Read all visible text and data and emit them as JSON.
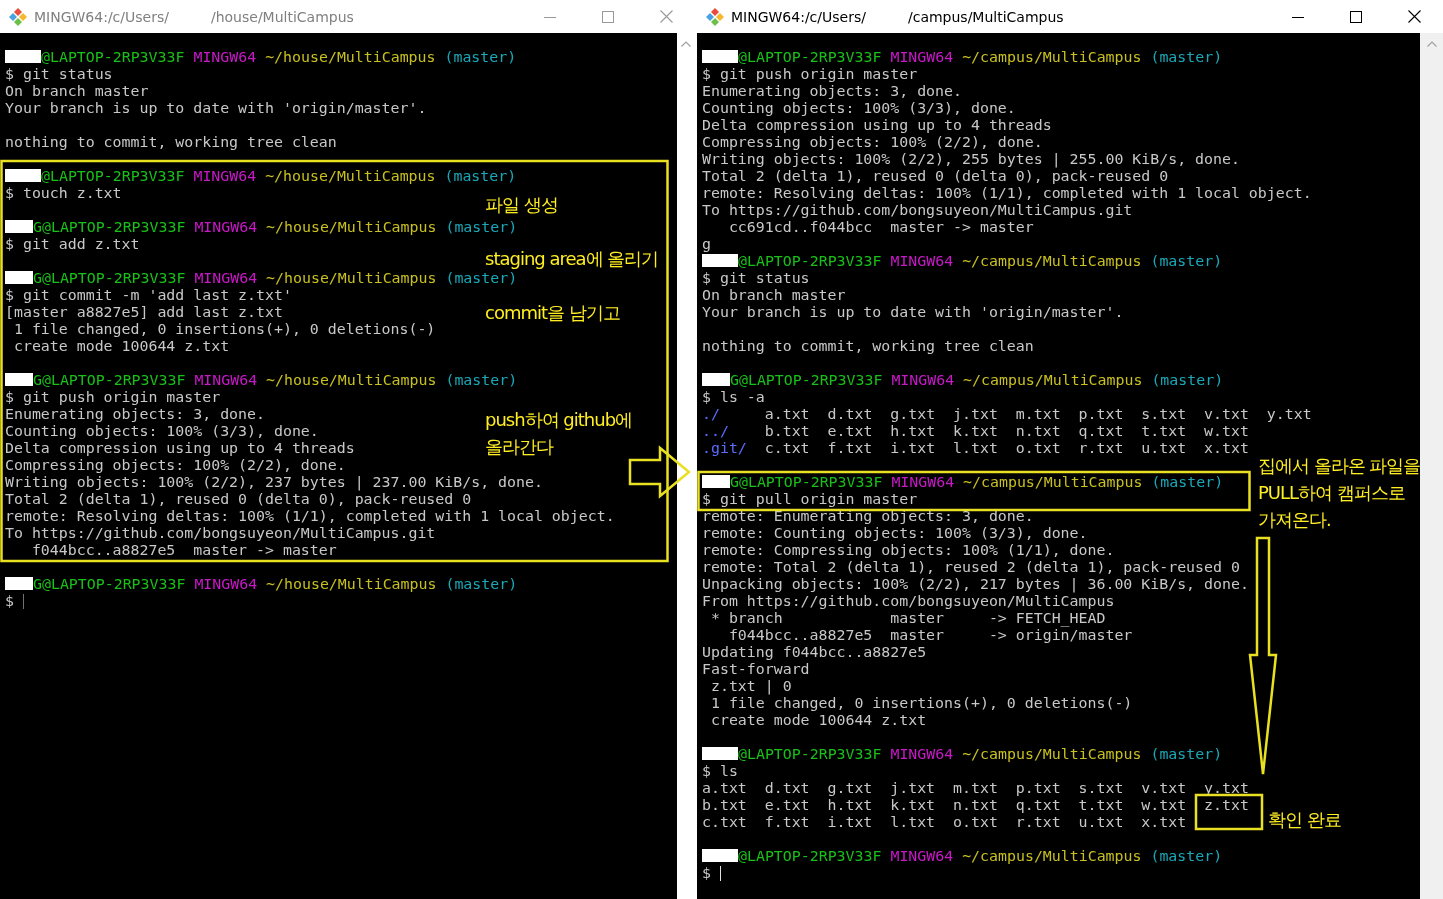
{
  "windows": [
    {
      "title_start": "MINGW64:/c/Users/",
      "title_end": "/house/MultiCampus",
      "active": false,
      "lines": [
        {
          "kind": "prompt",
          "host": "@LAPTOP-2RP3V33F",
          "system": "MINGW64",
          "path": "~/house/MultiCampus",
          "branch": "(master)"
        },
        {
          "kind": "output",
          "text": "$ git status"
        },
        {
          "kind": "output",
          "text": "On branch master"
        },
        {
          "kind": "output",
          "text": "Your branch is up to date with 'origin/master'."
        },
        {
          "kind": "blank"
        },
        {
          "kind": "output",
          "text": "nothing to commit, working tree clean"
        },
        {
          "kind": "blank"
        },
        {
          "kind": "prompt",
          "host": "@LAPTOP-2RP3V33F",
          "system": "MINGW64",
          "path": "~/house/MultiCampus",
          "branch": "(master)"
        },
        {
          "kind": "output",
          "text": "$ touch z.txt"
        },
        {
          "kind": "blank"
        },
        {
          "kind": "prompt",
          "user_fragment": "G",
          "host": "@LAPTOP-2RP3V33F",
          "system": "MINGW64",
          "path": "~/house/MultiCampus",
          "branch": "(master)"
        },
        {
          "kind": "output",
          "text": "$ git add z.txt"
        },
        {
          "kind": "blank"
        },
        {
          "kind": "prompt",
          "user_fragment": "G",
          "host": "@LAPTOP-2RP3V33F",
          "system": "MINGW64",
          "path": "~/house/MultiCampus",
          "branch": "(master)"
        },
        {
          "kind": "output",
          "text": "$ git commit -m 'add last z.txt'"
        },
        {
          "kind": "output",
          "text": "[master a8827e5] add last z.txt"
        },
        {
          "kind": "output",
          "text": " 1 file changed, 0 insertions(+), 0 deletions(-)"
        },
        {
          "kind": "output",
          "text": " create mode 100644 z.txt"
        },
        {
          "kind": "blank"
        },
        {
          "kind": "prompt",
          "user_fragment": "G",
          "host": "@LAPTOP-2RP3V33F",
          "system": "MINGW64",
          "path": "~/house/MultiCampus",
          "branch": "(master)"
        },
        {
          "kind": "output",
          "text": "$ git push origin master"
        },
        {
          "kind": "output",
          "text": "Enumerating objects: 3, done."
        },
        {
          "kind": "output",
          "text": "Counting objects: 100% (3/3), done."
        },
        {
          "kind": "output",
          "text": "Delta compression using up to 4 threads"
        },
        {
          "kind": "output",
          "text": "Compressing objects: 100% (2/2), done."
        },
        {
          "kind": "output",
          "text": "Writing objects: 100% (2/2), 237 bytes | 237.00 KiB/s, done."
        },
        {
          "kind": "output",
          "text": "Total 2 (delta 1), reused 0 (delta 0), pack-reused 0"
        },
        {
          "kind": "output",
          "text": "remote: Resolving deltas: 100% (1/1), completed with 1 local object."
        },
        {
          "kind": "output",
          "text": "To https://github.com/bongsuyeon/MultiCampus.git"
        },
        {
          "kind": "output",
          "text": "   f044bcc..a8827e5  master -> master"
        },
        {
          "kind": "blank"
        },
        {
          "kind": "prompt",
          "user_fragment": "G",
          "host": "@LAPTOP-2RP3V33F",
          "system": "MINGW64",
          "path": "~/house/MultiCampus",
          "branch": "(master)"
        },
        {
          "kind": "input",
          "text": "$"
        }
      ]
    },
    {
      "title_start": "MINGW64:/c/Users/",
      "title_end": "/campus/MultiCampus",
      "active": true,
      "lines": [
        {
          "kind": "prompt",
          "host": "@LAPTOP-2RP3V33F",
          "system": "MINGW64",
          "path": "~/campus/MultiCampus",
          "branch": "(master)"
        },
        {
          "kind": "output",
          "text": "$ git push origin master"
        },
        {
          "kind": "output",
          "text": "Enumerating objects: 3, done."
        },
        {
          "kind": "output",
          "text": "Counting objects: 100% (3/3), done."
        },
        {
          "kind": "output",
          "text": "Delta compression using up to 4 threads"
        },
        {
          "kind": "output",
          "text": "Compressing objects: 100% (2/2), done."
        },
        {
          "kind": "output",
          "text": "Writing objects: 100% (2/2), 255 bytes | 255.00 KiB/s, done."
        },
        {
          "kind": "output",
          "text": "Total 2 (delta 1), reused 0 (delta 0), pack-reused 0"
        },
        {
          "kind": "output",
          "text": "remote: Resolving deltas: 100% (1/1), completed with 1 local object."
        },
        {
          "kind": "output",
          "text": "To https://github.com/bongsuyeon/MultiCampus.git"
        },
        {
          "kind": "output",
          "text": "   cc691cd..f044bcc  master -> master"
        },
        {
          "kind": "output",
          "text": "g"
        },
        {
          "kind": "prompt",
          "host": "@LAPTOP-2RP3V33F",
          "system": "MINGW64",
          "path": "~/campus/MultiCampus",
          "branch": "(master)"
        },
        {
          "kind": "output",
          "text": "$ git status"
        },
        {
          "kind": "output",
          "text": "On branch master"
        },
        {
          "kind": "output",
          "text": "Your branch is up to date with 'origin/master'."
        },
        {
          "kind": "blank"
        },
        {
          "kind": "output",
          "text": "nothing to commit, working tree clean"
        },
        {
          "kind": "blank"
        },
        {
          "kind": "prompt",
          "user_fragment": "G",
          "host": "@LAPTOP-2RP3V33F",
          "system": "MINGW64",
          "path": "~/campus/MultiCampus",
          "branch": "(master)"
        },
        {
          "kind": "output",
          "text": "$ ls -a"
        },
        {
          "kind": "listing",
          "dir": "./",
          "files": "     a.txt  d.txt  g.txt  j.txt  m.txt  p.txt  s.txt  v.txt  y.txt"
        },
        {
          "kind": "listing",
          "dir": "../",
          "files": "    b.txt  e.txt  h.txt  k.txt  n.txt  q.txt  t.txt  w.txt"
        },
        {
          "kind": "listing",
          "dir": ".git/",
          "files": "  c.txt  f.txt  i.txt  l.txt  o.txt  r.txt  u.txt  x.txt"
        },
        {
          "kind": "blank"
        },
        {
          "kind": "prompt",
          "user_fragment": "G",
          "host": "@LAPTOP-2RP3V33F",
          "system": "MINGW64",
          "path": "~/campus/MultiCampus",
          "branch": "(master)"
        },
        {
          "kind": "output",
          "text": "$ git pull origin master"
        },
        {
          "kind": "output",
          "text": "remote: Enumerating objects: 3, done."
        },
        {
          "kind": "output",
          "text": "remote: Counting objects: 100% (3/3), done."
        },
        {
          "kind": "output",
          "text": "remote: Compressing objects: 100% (1/1), done."
        },
        {
          "kind": "output",
          "text": "remote: Total 2 (delta 1), reused 2 (delta 1), pack-reused 0"
        },
        {
          "kind": "output",
          "text": "Unpacking objects: 100% (2/2), 217 bytes | 36.00 KiB/s, done."
        },
        {
          "kind": "output",
          "text": "From https://github.com/bongsuyeon/MultiCampus"
        },
        {
          "kind": "output",
          "text": " * branch            master     -> FETCH_HEAD"
        },
        {
          "kind": "output",
          "text": "   f044bcc..a8827e5  master     -> origin/master"
        },
        {
          "kind": "output",
          "text": "Updating f044bcc..a8827e5"
        },
        {
          "kind": "output",
          "text": "Fast-forward"
        },
        {
          "kind": "output",
          "text": " z.txt | 0"
        },
        {
          "kind": "output",
          "text": " 1 file changed, 0 insertions(+), 0 deletions(-)"
        },
        {
          "kind": "output",
          "text": " create mode 100644 z.txt"
        },
        {
          "kind": "blank"
        },
        {
          "kind": "prompt",
          "host": "@LAPTOP-2RP3V33F",
          "system": "MINGW64",
          "path": "~/campus/MultiCampus",
          "branch": "(master)"
        },
        {
          "kind": "output",
          "text": "$ ls"
        },
        {
          "kind": "output",
          "text": "a.txt  d.txt  g.txt  j.txt  m.txt  p.txt  s.txt  v.txt  y.txt"
        },
        {
          "kind": "output",
          "text": "b.txt  e.txt  h.txt  k.txt  n.txt  q.txt  t.txt  w.txt  z.txt"
        },
        {
          "kind": "output",
          "text": "c.txt  f.txt  i.txt  l.txt  o.txt  r.txt  u.txt  x.txt"
        },
        {
          "kind": "blank"
        },
        {
          "kind": "prompt",
          "host": "@LAPTOP-2RP3V33F",
          "system": "MINGW64",
          "path": "~/campus/MultiCampus",
          "branch": "(master)"
        },
        {
          "kind": "input",
          "text": "$"
        }
      ]
    }
  ],
  "annotations": [
    {
      "lines": [
        "파일 생성"
      ]
    },
    {
      "lines": [
        "staging area에 올리기"
      ]
    },
    {
      "lines": [
        "commit을 남기고"
      ]
    },
    {
      "lines": [
        "push하여 github에",
        "올라간다"
      ]
    },
    {
      "lines": [
        "집에서 올라온 파일을",
        "PULL하여 캠퍼스로",
        "가져온다."
      ]
    },
    {
      "lines": [
        "확인 완료"
      ]
    }
  ]
}
